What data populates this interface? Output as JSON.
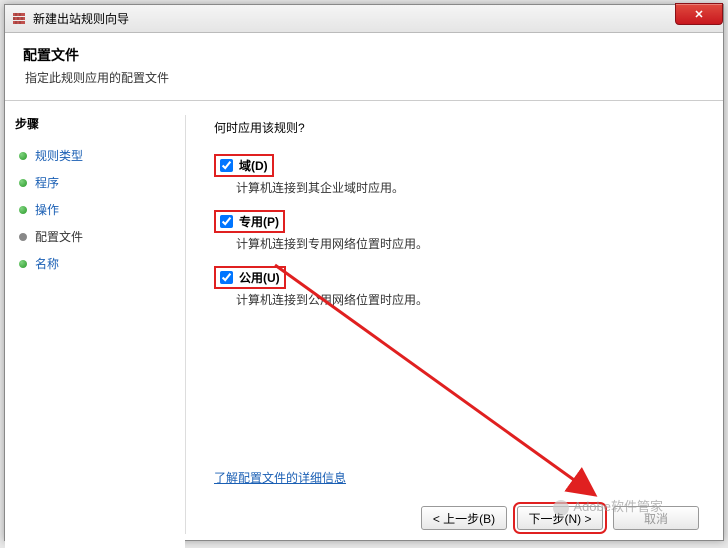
{
  "window": {
    "title": "新建出站规则向导"
  },
  "header": {
    "title": "配置文件",
    "subtitle": "指定此规则应用的配置文件"
  },
  "sidebar": {
    "heading": "步骤",
    "items": [
      {
        "label": "规则类型",
        "state": "done"
      },
      {
        "label": "程序",
        "state": "done"
      },
      {
        "label": "操作",
        "state": "done"
      },
      {
        "label": "配置文件",
        "state": "current"
      },
      {
        "label": "名称",
        "state": "done"
      }
    ]
  },
  "content": {
    "prompt": "何时应用该规则?",
    "options": [
      {
        "label": "域(D)",
        "checked": true,
        "desc": "计算机连接到其企业域时应用。"
      },
      {
        "label": "专用(P)",
        "checked": true,
        "desc": "计算机连接到专用网络位置时应用。"
      },
      {
        "label": "公用(U)",
        "checked": true,
        "desc": "计算机连接到公用网络位置时应用。"
      }
    ],
    "learn_more": "了解配置文件的详细信息"
  },
  "buttons": {
    "back": "< 上一步(B)",
    "next": "下一步(N) >",
    "cancel": "取消"
  },
  "watermark": "Adobe软件管家",
  "colors": {
    "highlight": "#e02020",
    "link": "#1a5fb4"
  }
}
